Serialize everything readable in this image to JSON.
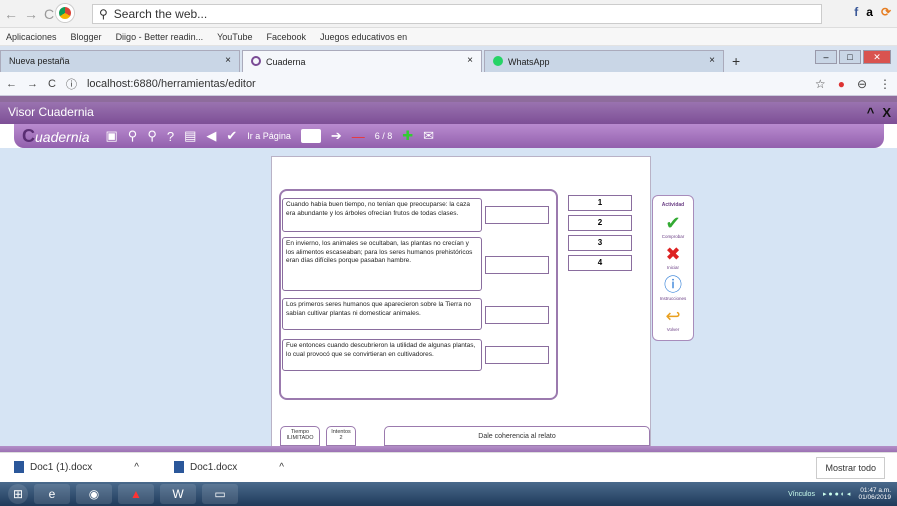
{
  "outer": {
    "search_placeholder": "Search the web...",
    "right_icons": [
      "f",
      "a",
      "⟳"
    ]
  },
  "bookmarks": [
    "Aplicaciones",
    "Blogger",
    "Diigo - Better readin...",
    "YouTube",
    "Facebook",
    "Juegos educativos en"
  ],
  "tabs": [
    {
      "label": "Nueva pestaña"
    },
    {
      "label": "Cuaderna"
    },
    {
      "label": "WhatsApp"
    }
  ],
  "address": {
    "url": "localhost:6880/herramientas/editor"
  },
  "app": {
    "title": "Visor Cuadernia",
    "brand": "uadernia",
    "goto_label": "Ir a Página",
    "page_counter": "6 / 8",
    "statements": [
      {
        "text": "Cuando había buen tiempo, no tenían que preocuparse: la caza era abundante y los árboles ofrecían frutos de todas clases."
      },
      {
        "text": "En invierno, los animales se ocultaban, las plantas no crecían y los alimentos escaseaban; para los seres humanos prehistóricos eran días difíciles porque pasaban hambre."
      },
      {
        "text": "Los primeros seres humanos que aparecieron sobre la Tierra no sabían cultivar plantas ni domesticar animales."
      },
      {
        "text": "Fue entonces cuando descubrieron la utilidad de algunas plantas, lo cual provocó que se convirtieran en cultivadores."
      }
    ],
    "numbers": [
      "1",
      "2",
      "3",
      "4"
    ],
    "sidebar": {
      "title": "Actividad",
      "check": "Comprobar",
      "reset": "Iniciar",
      "info": "Instrucciones",
      "back": "Volver"
    },
    "status": {
      "time_label": "Tiempo",
      "time_value": "ILIMITADO",
      "attempts_label": "Intentos",
      "attempts_value": "2",
      "instruction": "Dale coherencia al relato"
    }
  },
  "downloads": {
    "items": [
      "Doc1 (1).docx",
      "Doc1.docx"
    ],
    "show_all": "Mostrar todo"
  },
  "taskbar": {
    "tray_label": "Vínculos",
    "time": "01:47 a.m.",
    "date": "01/06/2019"
  }
}
